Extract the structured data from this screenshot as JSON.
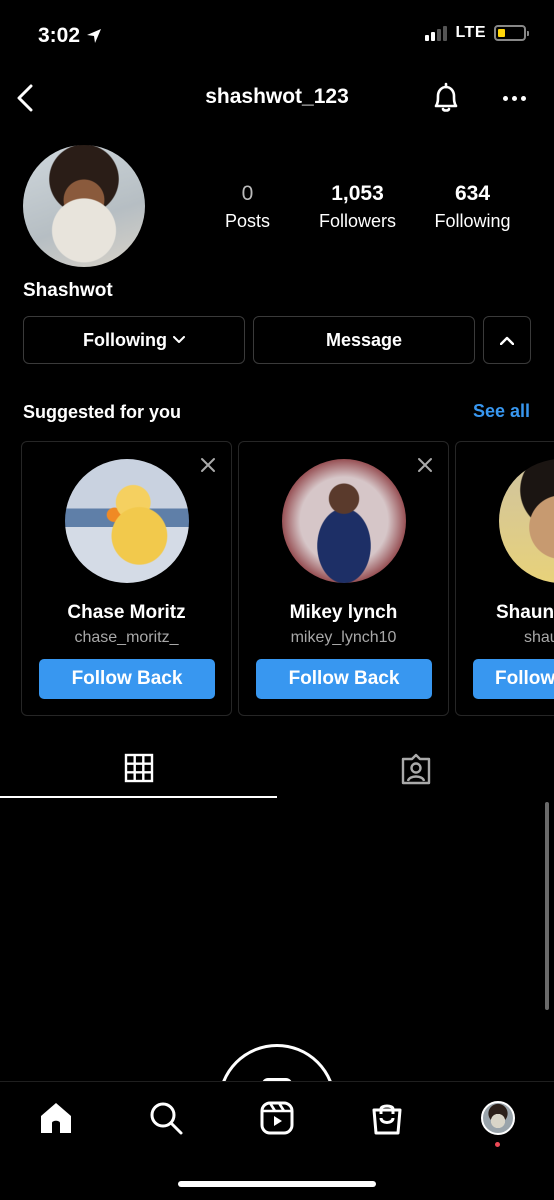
{
  "status_bar": {
    "time": "3:02",
    "network": "LTE",
    "battery_color": "#ffd60a"
  },
  "header": {
    "username": "shashwot_123"
  },
  "profile": {
    "display_name": "Shashwot",
    "stats": [
      {
        "value": "0",
        "label": "Posts"
      },
      {
        "value": "1,053",
        "label": "Followers"
      },
      {
        "value": "634",
        "label": "Following"
      }
    ]
  },
  "actions": {
    "following_label": "Following",
    "message_label": "Message"
  },
  "suggested": {
    "title": "Suggested for you",
    "see_all": "See all",
    "cards": [
      {
        "name": "Chase Moritz",
        "handle": "chase_moritz_",
        "button": "Follow Back"
      },
      {
        "name": "Mikey lynch",
        "handle": "mikey_lynch10",
        "button": "Follow Back"
      },
      {
        "name": "Shaun",
        "handle": "shau",
        "button": "Follow"
      }
    ]
  },
  "tabs": [
    {
      "icon": "grid-icon",
      "active": true
    },
    {
      "icon": "tagged-icon",
      "active": false
    }
  ],
  "bottom_nav": [
    "home-icon",
    "search-icon",
    "reels-icon",
    "shop-icon",
    "profile-avatar"
  ],
  "colors": {
    "accent": "#3897f0",
    "notification_dot": "#ed4956",
    "background": "#000000"
  }
}
